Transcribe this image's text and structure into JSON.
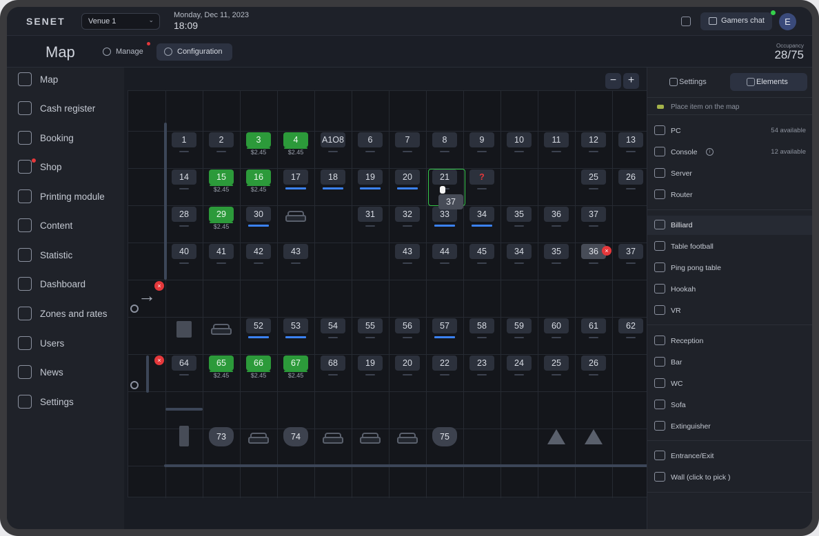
{
  "app": {
    "logo": "SENET"
  },
  "topbar": {
    "venue": "Venue 1",
    "date": "Monday, Dec 11, 2023",
    "time": "18:09",
    "chat_label": "Gamers chat",
    "avatar_letter": "E"
  },
  "header": {
    "title": "Map",
    "tabs": [
      {
        "label": "Manage"
      },
      {
        "label": "Configuration"
      }
    ],
    "occupancy_label": "Occupancy",
    "occupancy_value": "28/75"
  },
  "sidebar": {
    "items": [
      {
        "label": "Map",
        "icon": "map-icon"
      },
      {
        "label": "Cash register",
        "icon": "cash-register-icon"
      },
      {
        "label": "Booking",
        "icon": "booking-icon"
      },
      {
        "label": "Shop",
        "icon": "cart-icon"
      },
      {
        "label": "Printing module",
        "icon": "printer-icon"
      },
      {
        "label": "Content",
        "icon": "content-icon"
      },
      {
        "label": "Statistic",
        "icon": "chart-icon"
      },
      {
        "label": "Dashboard",
        "icon": "dashboard-icon"
      },
      {
        "label": "Zones and rates",
        "icon": "tag-icon"
      },
      {
        "label": "Users",
        "icon": "users-icon"
      },
      {
        "label": "News",
        "icon": "news-icon"
      },
      {
        "label": "Settings",
        "icon": "gear-icon"
      }
    ]
  },
  "map": {
    "zoom_out": "−",
    "zoom_in": "+",
    "drag_label": "37",
    "close_glyph": "×",
    "price": "$2.45",
    "rows": [
      [
        "1",
        "2",
        "3",
        "4",
        "A1O8",
        "6",
        "7",
        "8",
        "9",
        "10",
        "11",
        "12",
        "13"
      ],
      [
        "14",
        "15",
        "16",
        "17",
        "18",
        "19",
        "20",
        "21",
        "?",
        "25",
        "26"
      ],
      [
        "28",
        "29",
        "30",
        "31",
        "32",
        "33",
        "34",
        "35",
        "36",
        "37"
      ],
      [
        "40",
        "41",
        "42",
        "43",
        "43",
        "44",
        "45",
        "34",
        "35",
        "36",
        "37"
      ],
      [
        "52",
        "53",
        "54",
        "55",
        "56",
        "57",
        "58",
        "59",
        "60",
        "61",
        "62"
      ],
      [
        "64",
        "65",
        "66",
        "67",
        "68",
        "19",
        "20",
        "22",
        "23",
        "24",
        "25",
        "26"
      ]
    ],
    "consoles": [
      "73",
      "74",
      "75"
    ]
  },
  "panel": {
    "tabs": [
      {
        "label": "Settings"
      },
      {
        "label": "Elements"
      }
    ],
    "hint": "Place item on the map",
    "groups": [
      [
        {
          "label": "PC",
          "available": "54 available",
          "icon": "monitor-icon"
        },
        {
          "label": "Console",
          "available": "12 available",
          "icon": "gamepad-icon",
          "info": "i"
        },
        {
          "label": "Server",
          "icon": "server-icon"
        },
        {
          "label": "Router",
          "icon": "router-icon"
        }
      ],
      [
        {
          "label": "Billiard",
          "icon": "billiard-icon",
          "active": true
        },
        {
          "label": "Table football",
          "icon": "football-icon"
        },
        {
          "label": "Ping pong table",
          "icon": "ping-pong-icon"
        },
        {
          "label": "Hookah",
          "icon": "hookah-icon"
        },
        {
          "label": "VR",
          "icon": "vr-icon"
        }
      ],
      [
        {
          "label": "Reception",
          "icon": "reception-icon"
        },
        {
          "label": "Bar",
          "icon": "cocktail-icon"
        },
        {
          "label": "WC",
          "icon": "wc-icon"
        },
        {
          "label": "Sofa",
          "icon": "sofa-icon"
        },
        {
          "label": "Extinguisher",
          "icon": "extinguisher-icon"
        }
      ],
      [
        {
          "label": "Entrance/Exit",
          "icon": "arrow-right-icon"
        },
        {
          "label": "Wall (click to pick )",
          "icon": "wall-icon"
        }
      ]
    ]
  },
  "colors": {
    "background": "#1b1e26",
    "occupied_green": "#2c9a3a",
    "booked_blue": "#3b82f6",
    "alert_red": "#e5383b",
    "selection_green": "#35c94a"
  }
}
